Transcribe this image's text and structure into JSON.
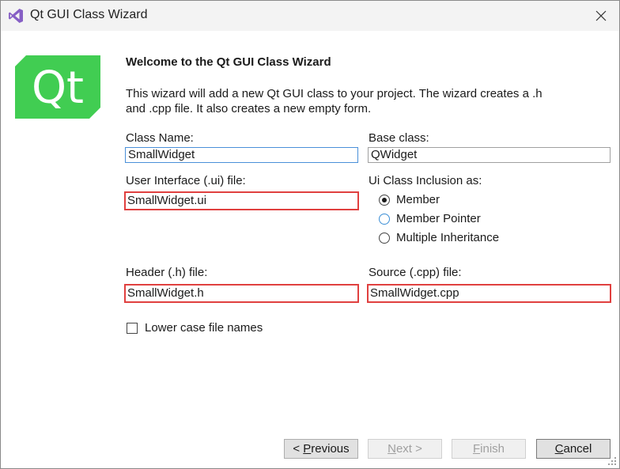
{
  "window": {
    "title": "Qt GUI Class Wizard",
    "icon": "visual-studio-icon",
    "close_icon": "close-icon"
  },
  "logo": {
    "text": "Qt",
    "color": "#41cd52"
  },
  "intro": {
    "heading": "Welcome to the Qt GUI Class Wizard",
    "line1": "This wizard will add a new Qt GUI class to your project. The wizard creates a .h",
    "line2": "and .cpp file. It also creates a new empty form."
  },
  "form": {
    "class_name_label": "Class Name:",
    "class_name_value": "SmallWidget",
    "base_class_label": "Base class:",
    "base_class_value": "QWidget",
    "ui_file_label": "User Interface (.ui) file:",
    "ui_file_value": "SmallWidget.ui",
    "inclusion_label": "Ui Class Inclusion as:",
    "inclusion_options": [
      "Member",
      "Member Pointer",
      "Multiple Inheritance"
    ],
    "inclusion_selected": "Member",
    "header_label": "Header (.h) file:",
    "header_value": "SmallWidget.h",
    "source_label": "Source (.cpp) file:",
    "source_value": "SmallWidget.cpp",
    "lowercase_label": "Lower case file names",
    "lowercase_checked": false
  },
  "buttons": {
    "previous_prefix": "< ",
    "previous_mnemonic": "P",
    "previous_rest": "revious",
    "next_mnemonic": "N",
    "next_rest": "ext >",
    "finish_mnemonic": "F",
    "finish_rest": "inish",
    "cancel_mnemonic": "C",
    "cancel_rest": "ancel"
  },
  "colors": {
    "error_border": "#e0403f",
    "focus_border": "#4a90d9",
    "vs_purple": "#865fc5"
  }
}
